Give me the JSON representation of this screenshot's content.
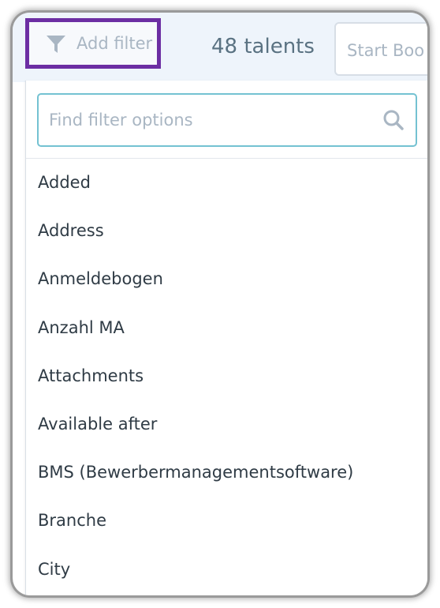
{
  "toolbar": {
    "add_filter_label": "Add filter",
    "talent_count": "48 talents",
    "start_button_label": "Start Boo",
    "accent_color": "#6c2ea3"
  },
  "filter_menu": {
    "search_placeholder": "Find filter options",
    "search_value": "",
    "options": [
      "Added",
      "Address",
      "Anmeldebogen",
      "Anzahl MA",
      "Attachments",
      "Available after",
      "BMS (Bewerbermanagementsoftware)",
      "Branche",
      "City"
    ]
  },
  "icons": {
    "filter": "funnel-icon",
    "search": "search-icon"
  }
}
